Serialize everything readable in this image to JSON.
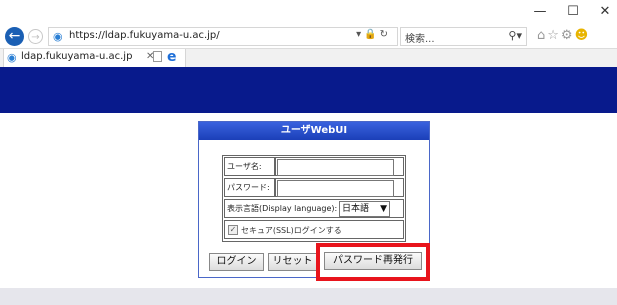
{
  "browser": {
    "url": "https://ldap.fukuyama-u.ac.jp/",
    "search_placeholder": "検索...",
    "tab_title": "ldap.fukuyama-u.ac.jp",
    "window_controls": {
      "minimize": "—",
      "maximize": "☐",
      "close": "✕"
    },
    "icons": [
      "back-arrow-icon",
      "forward-arrow-icon",
      "ie-page-icon",
      "lock-icon",
      "refresh-icon",
      "search-icon",
      "home-icon",
      "star-icon",
      "gear-icon",
      "smiley-icon",
      "new-tab-icon",
      "edge-icon"
    ]
  },
  "colors": {
    "banner": "#081a8c",
    "panel_header": "#2a50d0",
    "highlight": "#e8141c"
  },
  "panel": {
    "title": "ユーザWebUI",
    "fields": {
      "username_label": "ユーザ名:",
      "username_value": "",
      "password_label": "パスワード:",
      "password_value": "",
      "language_label": "表示言語(Display language):",
      "language_selected": "日本語",
      "ssl_label": "セキュア(SSL)ログインする",
      "ssl_checked": true
    },
    "buttons": {
      "login": "ログイン",
      "reset": "リセット",
      "reissue_password": "パスワード再発行"
    }
  }
}
